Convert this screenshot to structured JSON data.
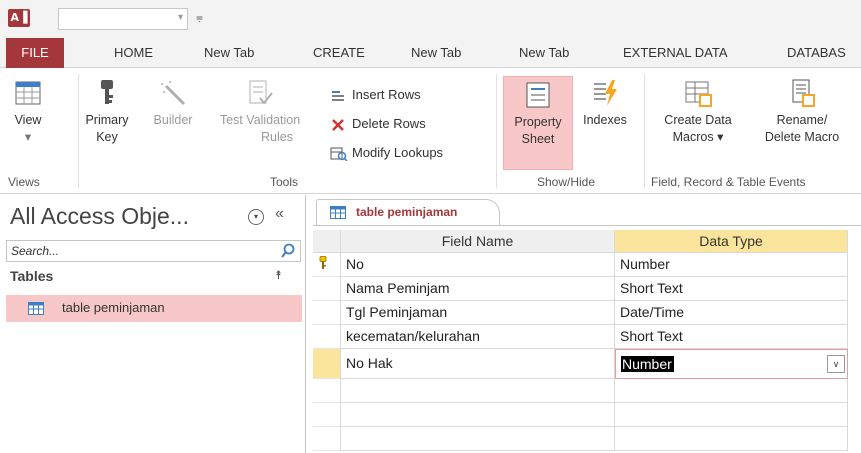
{
  "qat": {
    "logo_text": "A▐",
    "customize_glyph": "⩦"
  },
  "tabs": [
    {
      "label": "FILE"
    },
    {
      "label": "HOME"
    },
    {
      "label": "New Tab"
    },
    {
      "label": "CREATE"
    },
    {
      "label": "New Tab"
    },
    {
      "label": "New Tab"
    },
    {
      "label": "EXTERNAL DATA"
    },
    {
      "label": "DATABAS"
    }
  ],
  "ribbon": {
    "views": {
      "view_label": "View",
      "view_arrow": "▾",
      "group_label": "Views"
    },
    "tools": {
      "primary_key_line1": "Primary",
      "primary_key_line2": "Key",
      "builder_label": "Builder",
      "test_validation_line1": "Test Validation",
      "test_validation_line2": "Rules",
      "insert_rows": "Insert Rows",
      "delete_rows": "Delete Rows",
      "modify_lookups": "Modify Lookups",
      "group_label": "Tools"
    },
    "show_hide": {
      "property_sheet_line1": "Property",
      "property_sheet_line2": "Sheet",
      "indexes_label": "Indexes",
      "group_label": "Show/Hide"
    },
    "events": {
      "create_data_line1": "Create Data",
      "create_data_line2": "Macros ▾",
      "rename_line1": "Rename/",
      "rename_line2": "Delete Macro",
      "group_label": "Field, Record & Table Events"
    }
  },
  "nav": {
    "title": "All Access Obje...",
    "collapse_glyph": "«",
    "dropdown_glyph": "▾",
    "search_placeholder": "Search...",
    "section_label": "Tables",
    "section_toggle": "⯭",
    "items": [
      {
        "label": "table peminjaman"
      }
    ]
  },
  "document": {
    "tab_label": "table peminjaman",
    "headers": {
      "field_name": "Field Name",
      "data_type": "Data Type"
    },
    "rows": [
      {
        "field": "No",
        "type": "Number",
        "primary_key": true
      },
      {
        "field": "Nama Peminjam",
        "type": "Short Text"
      },
      {
        "field": "Tgl Peminjaman",
        "type": "Date/Time"
      },
      {
        "field": "kecematan/kelurahan",
        "type": "Short Text"
      },
      {
        "field": "No Hak",
        "type": "Number",
        "current": true
      },
      {
        "field": "",
        "type": ""
      },
      {
        "field": "",
        "type": ""
      },
      {
        "field": "",
        "type": ""
      }
    ],
    "dropdown_glyph": "∨"
  },
  "colors": {
    "accent": "#a4373a",
    "selected_fill": "#f8c8c9",
    "column_highlight": "#fbe49b"
  }
}
